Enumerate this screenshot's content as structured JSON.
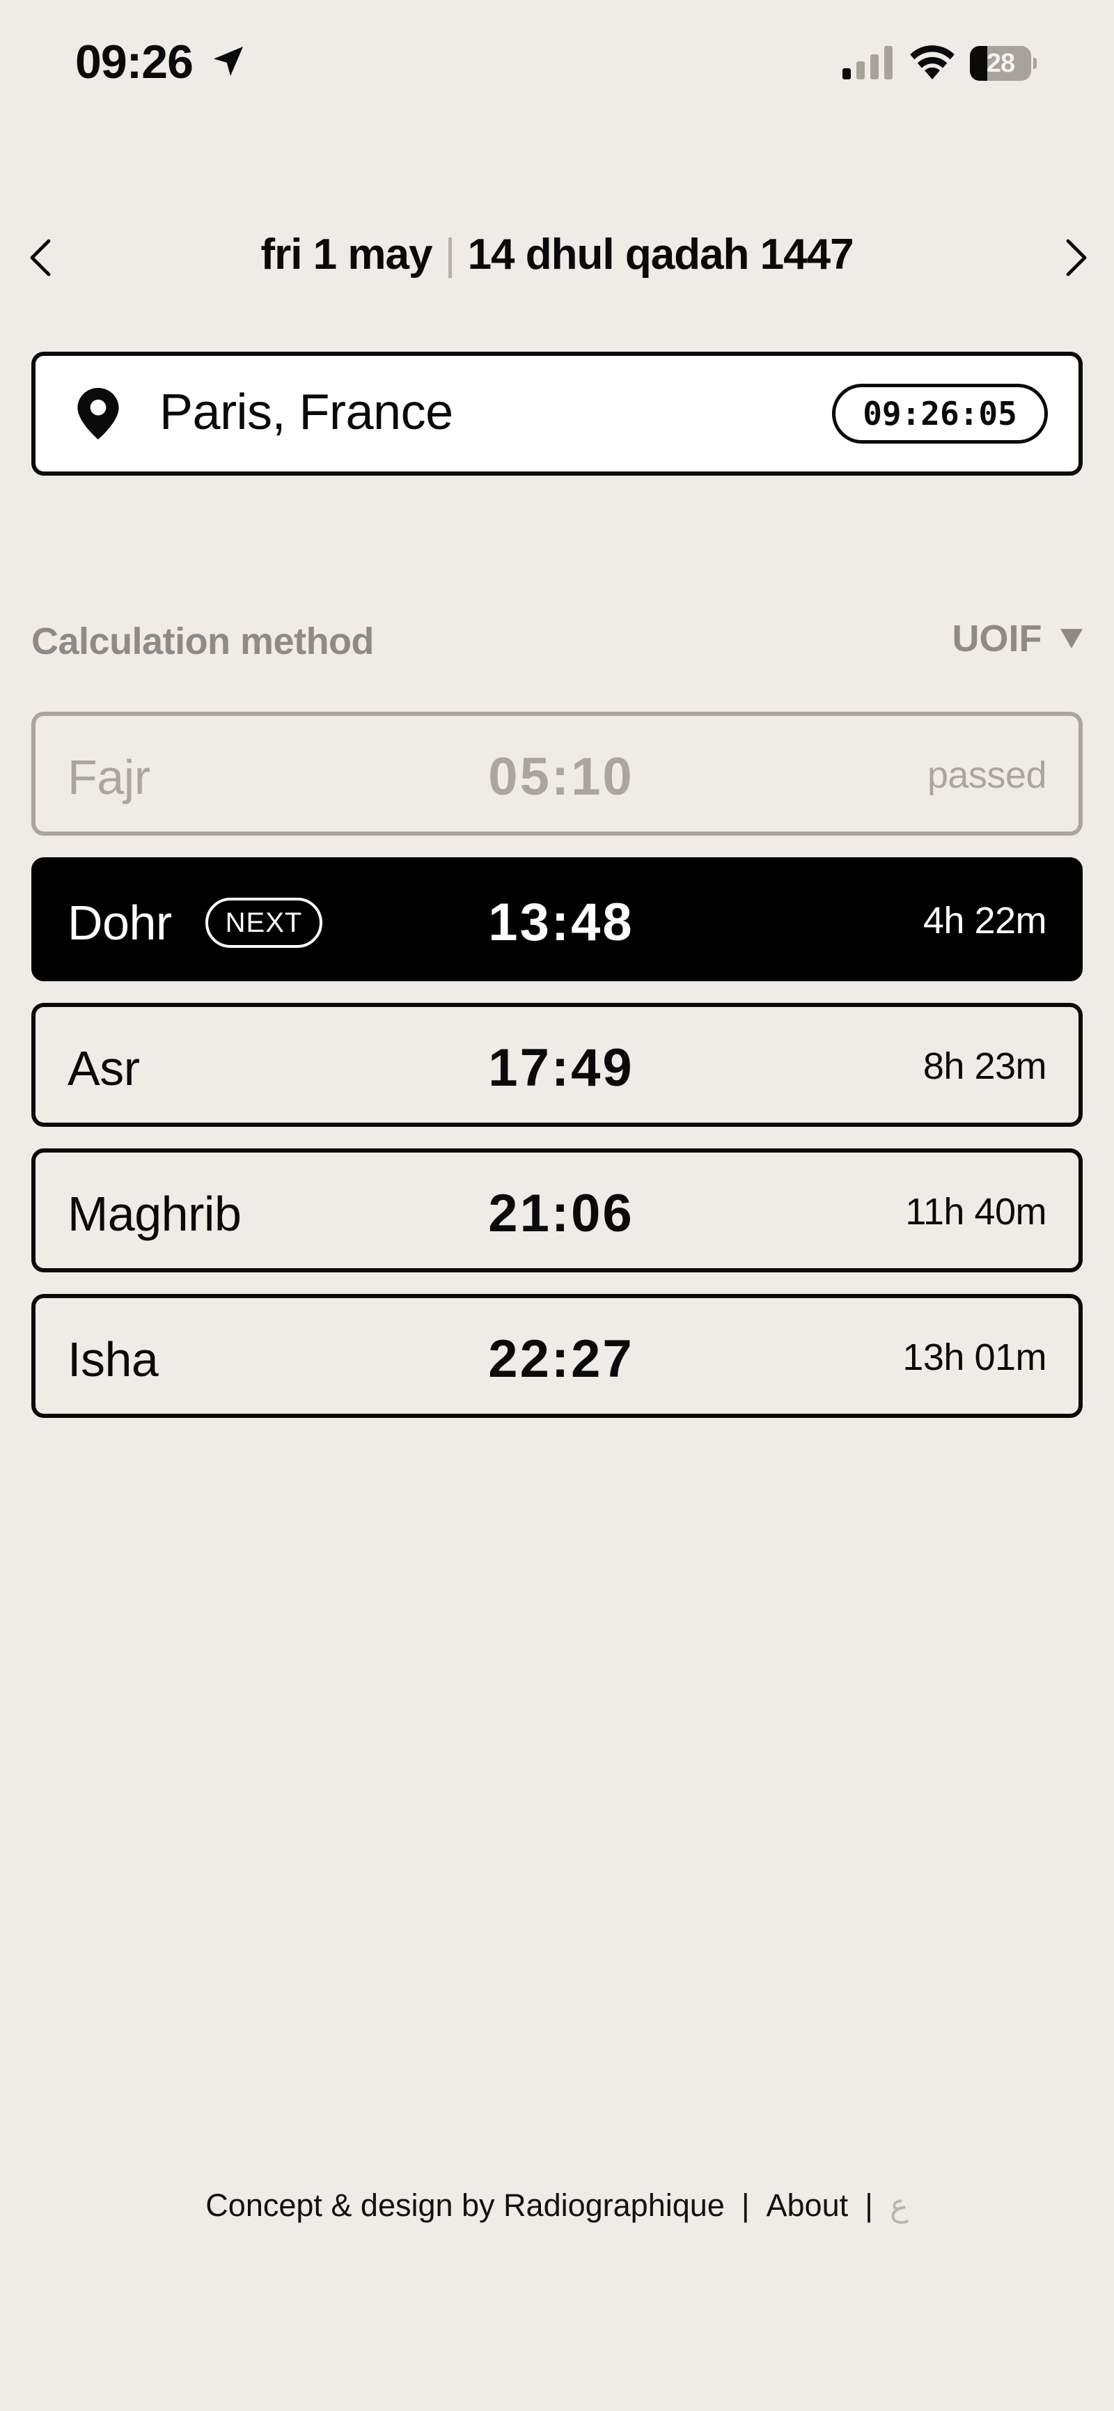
{
  "status_bar": {
    "time": "09:26",
    "battery_level": "28",
    "battery_fraction": 0.28,
    "icons": [
      "location-arrow-icon",
      "cellular-signal-icon",
      "wifi-icon",
      "battery-icon"
    ]
  },
  "date_nav": {
    "gregorian": "fri 1 may",
    "separator": "|",
    "hijri": "14 dhul qadah 1447",
    "prev_icon": "chevron-left-icon",
    "next_icon": "chevron-right-icon"
  },
  "location": {
    "icon": "map-pin-icon",
    "name": "Paris, France",
    "clock": "09:26:05"
  },
  "calculation": {
    "label": "Calculation method",
    "value": "UOIF",
    "caret_icon": "caret-down-icon"
  },
  "prayers": [
    {
      "name": "Fajr",
      "time": "05:10",
      "remaining": "passed",
      "state": "passed"
    },
    {
      "name": "Dohr",
      "badge": "NEXT",
      "time": "13:48",
      "remaining": "4h 22m",
      "state": "next"
    },
    {
      "name": "Asr",
      "time": "17:49",
      "remaining": "8h 23m",
      "state": "upcoming"
    },
    {
      "name": "Maghrib",
      "time": "21:06",
      "remaining": "11h 40m",
      "state": "upcoming"
    },
    {
      "name": "Isha",
      "time": "22:27",
      "remaining": "13h 01m",
      "state": "upcoming"
    }
  ],
  "footer": {
    "credit": "Concept & design by Radiographique",
    "separator": "|",
    "about": "About",
    "language": "ع"
  },
  "colors": {
    "background": "#efebe6",
    "ink": "#0a0a0a",
    "muted": "#8f8a85",
    "passed": "#aaa59f",
    "card": "#ffffff",
    "highlight": "#000000"
  }
}
